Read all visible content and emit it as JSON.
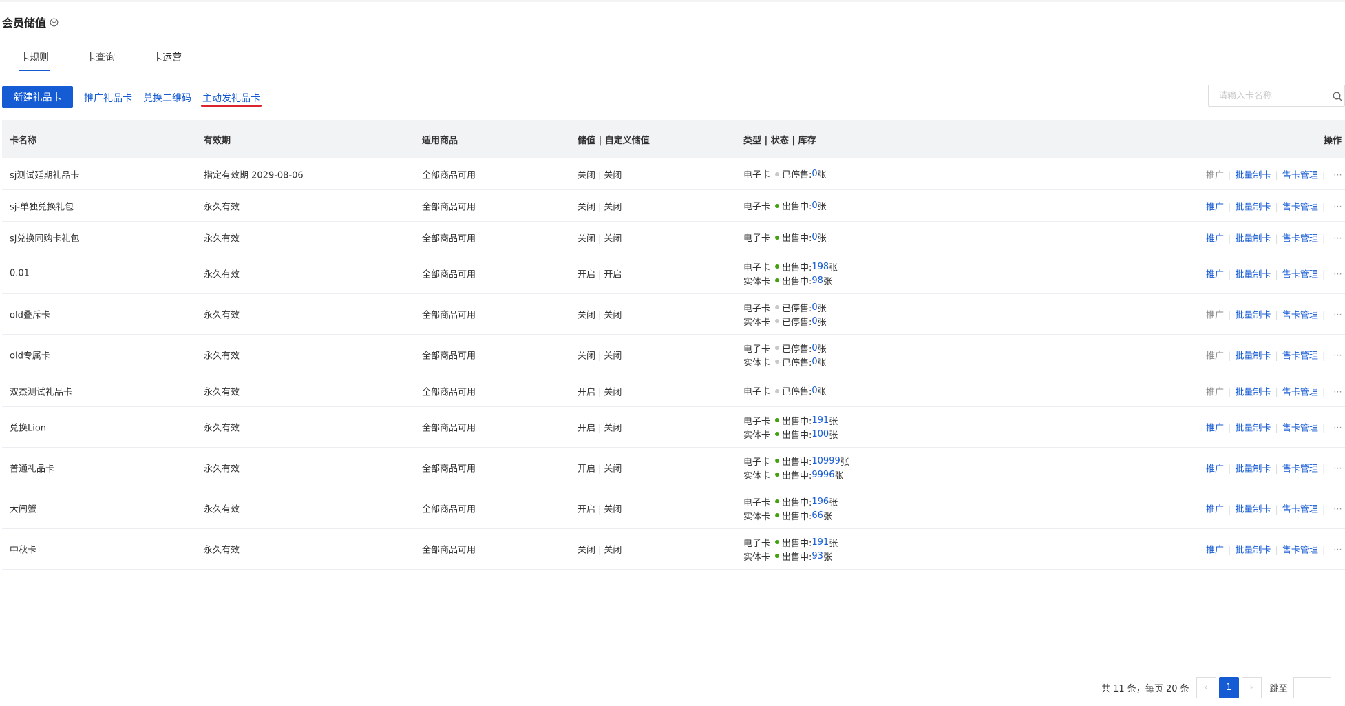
{
  "page": {
    "title": "会员储值",
    "title_icon": "chevron-circle-down-icon"
  },
  "tabs": [
    {
      "label": "卡规则",
      "active": true
    },
    {
      "label": "卡查询",
      "active": false
    },
    {
      "label": "卡运营",
      "active": false
    }
  ],
  "toolbar": {
    "new_button": "新建礼品卡",
    "links": [
      "推广礼品卡",
      "兑换二维码",
      "主动发礼品卡"
    ],
    "highlighted_link_color": "#d9232d"
  },
  "search": {
    "placeholder": "请输入卡名称",
    "value": "",
    "icon": "search-icon"
  },
  "table": {
    "headers": [
      "卡名称",
      "有效期",
      "适用商品",
      "储值 | 自定义储值",
      "类型 | 状态 | 库存",
      "操作"
    ],
    "ops": [
      "推广",
      "批量制卡",
      "售卡管理"
    ],
    "more": "···",
    "rows": [
      {
        "name": "sj测试延期礼品卡",
        "valid": "指定有效期 2029-08-06",
        "goods": "全部商品可用",
        "store": "关闭",
        "custom": "关闭",
        "promo_disabled": true,
        "types": [
          {
            "kind": "电子卡",
            "status": "已停售:",
            "on": false,
            "stock": "0",
            "unit": "张"
          }
        ]
      },
      {
        "name": "sj-单独兑换礼包",
        "valid": "永久有效",
        "goods": "全部商品可用",
        "store": "关闭",
        "custom": "关闭",
        "promo_disabled": false,
        "types": [
          {
            "kind": "电子卡",
            "status": "出售中:",
            "on": true,
            "stock": "0",
            "unit": "张"
          }
        ]
      },
      {
        "name": "sj兑换同购卡礼包",
        "valid": "永久有效",
        "goods": "全部商品可用",
        "store": "关闭",
        "custom": "关闭",
        "promo_disabled": false,
        "types": [
          {
            "kind": "电子卡",
            "status": "出售中:",
            "on": true,
            "stock": "0",
            "unit": "张"
          }
        ]
      },
      {
        "name": "0.01",
        "valid": "永久有效",
        "goods": "全部商品可用",
        "store": "开启",
        "custom": "开启",
        "promo_disabled": false,
        "types": [
          {
            "kind": "电子卡",
            "status": "出售中:",
            "on": true,
            "stock": "198",
            "unit": "张"
          },
          {
            "kind": "实体卡",
            "status": "出售中:",
            "on": true,
            "stock": "98",
            "unit": "张"
          }
        ]
      },
      {
        "name": "old叠斥卡",
        "valid": "永久有效",
        "goods": "全部商品可用",
        "store": "关闭",
        "custom": "关闭",
        "promo_disabled": true,
        "types": [
          {
            "kind": "电子卡",
            "status": "已停售:",
            "on": false,
            "stock": "0",
            "unit": "张"
          },
          {
            "kind": "实体卡",
            "status": "已停售:",
            "on": false,
            "stock": "0",
            "unit": "张"
          }
        ]
      },
      {
        "name": "old专属卡",
        "valid": "永久有效",
        "goods": "全部商品可用",
        "store": "关闭",
        "custom": "关闭",
        "promo_disabled": true,
        "types": [
          {
            "kind": "电子卡",
            "status": "已停售:",
            "on": false,
            "stock": "0",
            "unit": "张"
          },
          {
            "kind": "实体卡",
            "status": "已停售:",
            "on": false,
            "stock": "0",
            "unit": "张"
          }
        ]
      },
      {
        "name": "双杰测试礼品卡",
        "valid": "永久有效",
        "goods": "全部商品可用",
        "store": "开启",
        "custom": "关闭",
        "promo_disabled": true,
        "types": [
          {
            "kind": "电子卡",
            "status": "已停售:",
            "on": false,
            "stock": "0",
            "unit": "张"
          }
        ]
      },
      {
        "name": "兑换Lion",
        "valid": "永久有效",
        "goods": "全部商品可用",
        "store": "开启",
        "custom": "关闭",
        "promo_disabled": false,
        "types": [
          {
            "kind": "电子卡",
            "status": "出售中:",
            "on": true,
            "stock": "191",
            "unit": "张"
          },
          {
            "kind": "实体卡",
            "status": "出售中:",
            "on": true,
            "stock": "100",
            "unit": "张"
          }
        ]
      },
      {
        "name": "普通礼品卡",
        "valid": "永久有效",
        "goods": "全部商品可用",
        "store": "开启",
        "custom": "关闭",
        "promo_disabled": false,
        "types": [
          {
            "kind": "电子卡",
            "status": "出售中:",
            "on": true,
            "stock": "10999",
            "unit": "张"
          },
          {
            "kind": "实体卡",
            "status": "出售中:",
            "on": true,
            "stock": "9996",
            "unit": "张"
          }
        ]
      },
      {
        "name": "大闸蟹",
        "valid": "永久有效",
        "goods": "全部商品可用",
        "store": "开启",
        "custom": "关闭",
        "promo_disabled": false,
        "types": [
          {
            "kind": "电子卡",
            "status": "出售中:",
            "on": true,
            "stock": "196",
            "unit": "张"
          },
          {
            "kind": "实体卡",
            "status": "出售中:",
            "on": true,
            "stock": "66",
            "unit": "张"
          }
        ]
      },
      {
        "name": "中秋卡",
        "valid": "永久有效",
        "goods": "全部商品可用",
        "store": "关闭",
        "custom": "关闭",
        "promo_disabled": false,
        "types": [
          {
            "kind": "电子卡",
            "status": "出售中:",
            "on": true,
            "stock": "191",
            "unit": "张"
          },
          {
            "kind": "实体卡",
            "status": "出售中:",
            "on": true,
            "stock": "93",
            "unit": "张"
          }
        ]
      }
    ]
  },
  "pagination": {
    "summary": "共 11 条，每页 20 条",
    "prev": "‹",
    "current": "1",
    "next": "›",
    "jump_label": "跳至",
    "jump_value": ""
  },
  "colors": {
    "primary": "#155bd4",
    "active_dot": "#45a110",
    "inactive_dot": "#c8c9cc",
    "header_bg": "#f2f3f5"
  }
}
